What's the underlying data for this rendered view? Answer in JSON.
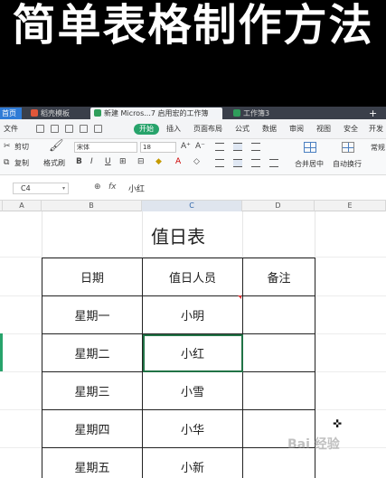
{
  "banner": {
    "title": "简单表格制作方法"
  },
  "tabs": {
    "home": "首页",
    "items": [
      {
        "label": "稻壳模板",
        "color": "#e2573a"
      },
      {
        "label": "新建 Micros...7 启用宏的工作簿",
        "color": "#2f9e5b"
      },
      {
        "label": "工作簿3",
        "color": "#2f9e5b"
      }
    ],
    "add": "+"
  },
  "menu": {
    "items": [
      "文件",
      "开始",
      "插入",
      "页面布局",
      "公式",
      "数据",
      "审阅",
      "视图",
      "安全",
      "开发"
    ]
  },
  "ribbon": {
    "cut": "剪切",
    "copy": "复制",
    "format_painter": "格式刷",
    "font_name": "宋体",
    "font_size": "18",
    "bold": "B",
    "italic": "I",
    "underline": "U",
    "merge_center": "合并居中",
    "wrap_text": "自动换行",
    "normal": "常规",
    "grow_font": "A⁺",
    "shrink_font": "A⁻"
  },
  "formula_bar": {
    "cell_ref": "C4",
    "fx": "fx",
    "value": "小红"
  },
  "columns": {
    "A": "A",
    "B": "B",
    "C": "C",
    "D": "D",
    "E": "E"
  },
  "sheet": {
    "title": "值日表",
    "headers": [
      "日期",
      "值日人员",
      "备注"
    ],
    "rows": [
      [
        "星期一",
        "小明",
        ""
      ],
      [
        "星期二",
        "小红",
        ""
      ],
      [
        "星期三",
        "小雪",
        ""
      ],
      [
        "星期四",
        "小华",
        ""
      ],
      [
        "星期五",
        "小新",
        ""
      ]
    ]
  },
  "watermark": "Bai 经验",
  "colors": {
    "accent": "#27a36b",
    "selection": "#217346",
    "title_bar": "#3a3f4a"
  }
}
